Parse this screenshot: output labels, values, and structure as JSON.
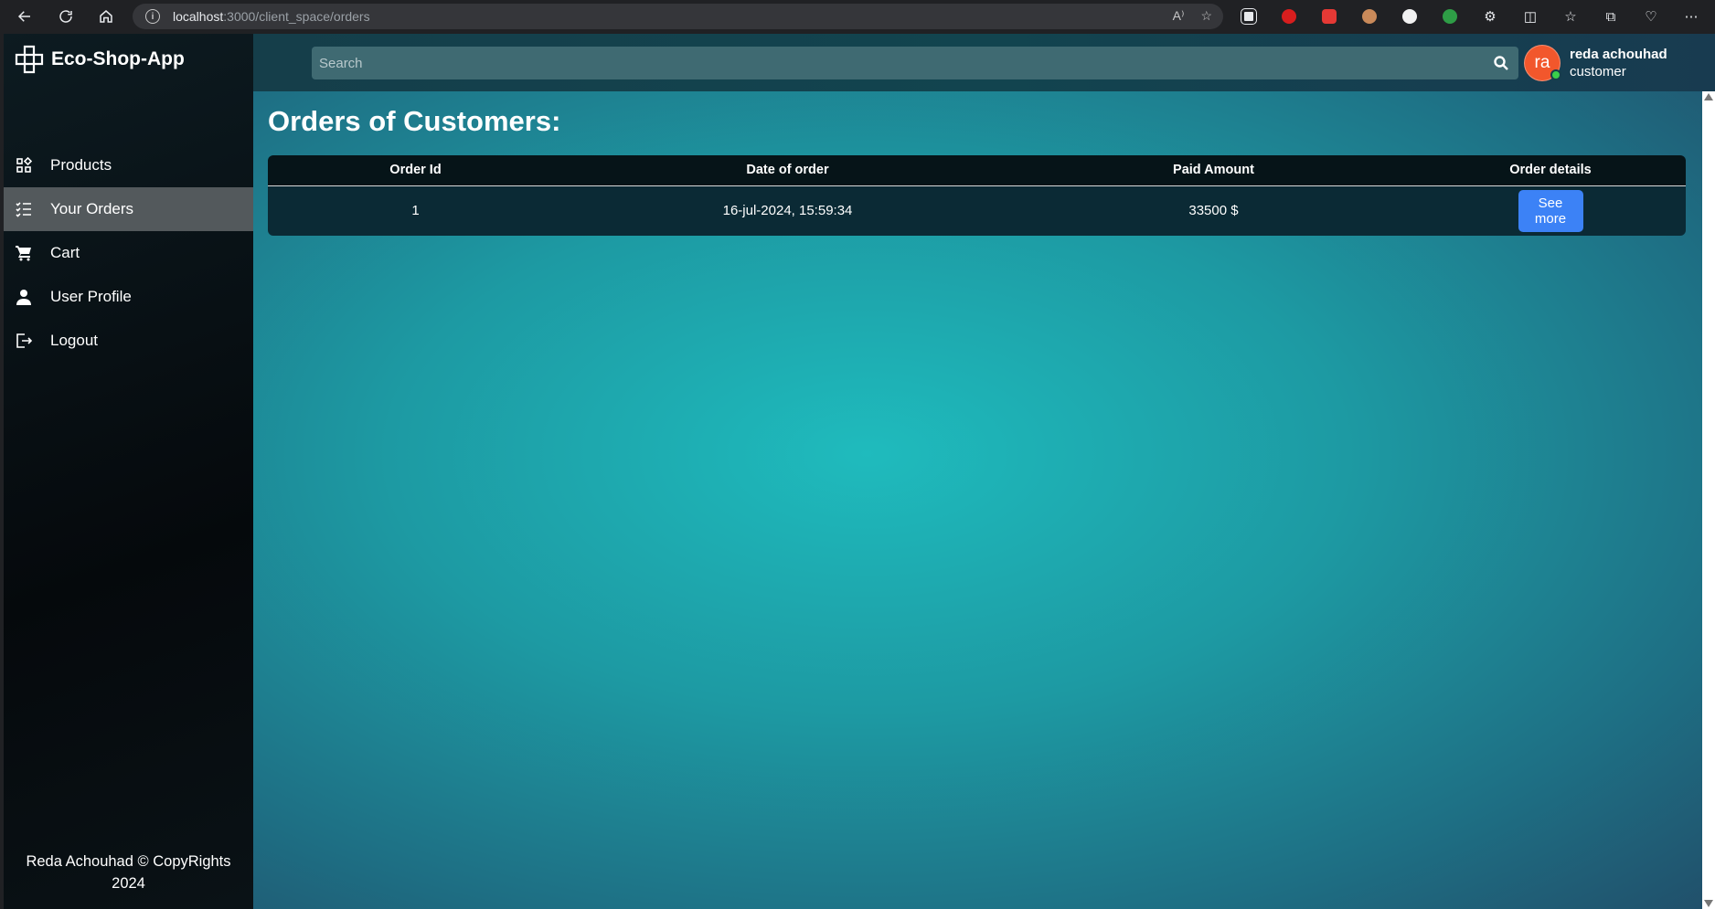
{
  "browser": {
    "url_host": "localhost",
    "url_path": ":3000/client_space/orders",
    "read_aloud_label": "A⁾"
  },
  "sidebar": {
    "brand": "Eco-Shop-App",
    "items": [
      {
        "label": "Products",
        "icon": "grid-icon",
        "active": false
      },
      {
        "label": "Your Orders",
        "icon": "checklist-icon",
        "active": true
      },
      {
        "label": "Cart",
        "icon": "cart-icon",
        "active": false
      },
      {
        "label": "User Profile",
        "icon": "person-icon",
        "active": false
      },
      {
        "label": "Logout",
        "icon": "logout-icon",
        "active": false
      }
    ],
    "footer": "Reda Achouhad © CopyRights 2024"
  },
  "topbar": {
    "search_placeholder": "Search",
    "user": {
      "initials": "ra",
      "name": "reda achouhad",
      "role": "customer",
      "avatar_color": "#f2572c",
      "status_color": "#3ad04a"
    }
  },
  "main": {
    "title": "Orders of Customers:",
    "table": {
      "headers": [
        "Order Id",
        "Date of order",
        "Paid Amount",
        "Order details"
      ],
      "rows": [
        {
          "id": "1",
          "date": "16-jul-2024, 15:59:34",
          "amount": "33500 $",
          "action": "See more"
        }
      ]
    },
    "accent_color": "#3c82f6"
  }
}
